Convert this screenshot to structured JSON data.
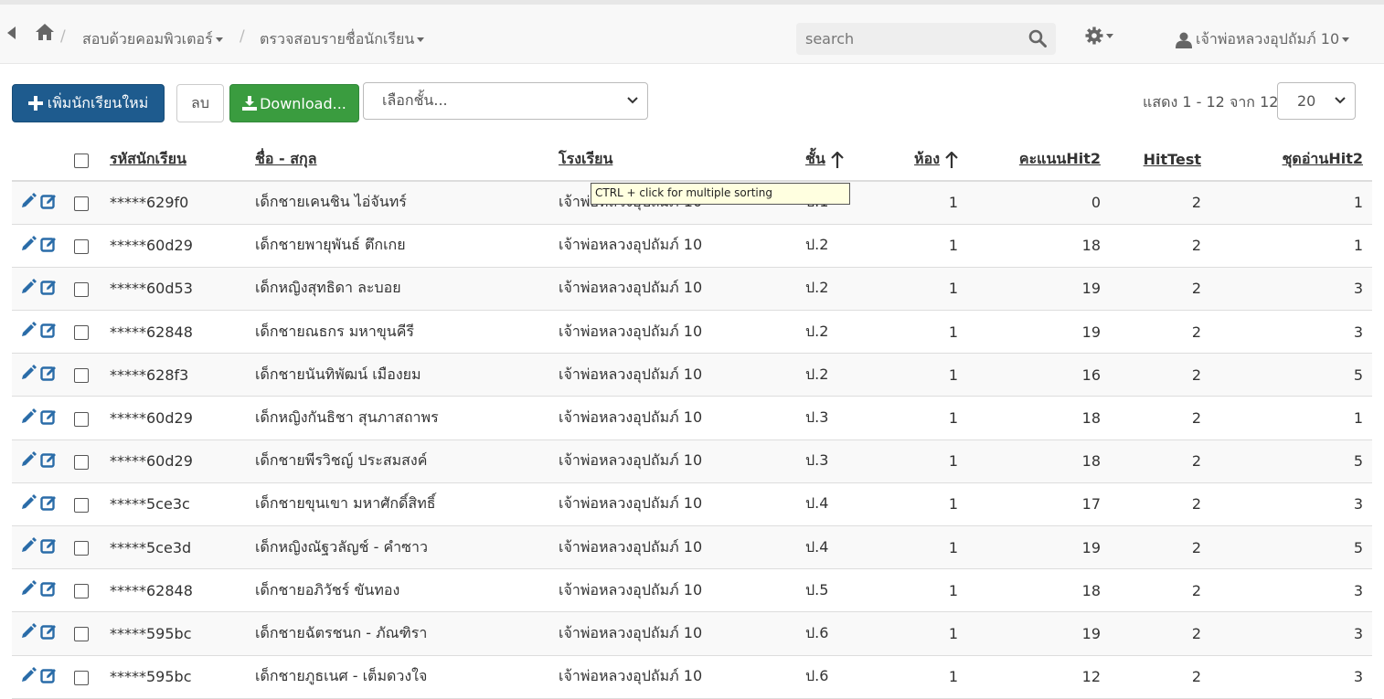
{
  "breadcrumb": {
    "menu1": "สอบด้วยคอมพิวเตอร์",
    "menu2": "ตรวจสอบรายชื่อนักเรียน"
  },
  "search": {
    "placeholder": "search"
  },
  "user": {
    "name": "เจ้าพ่อหลวงอุปถัมภ์ 10"
  },
  "toolbar": {
    "add_label": "เพิ่มนักเรียนใหม่",
    "delete_label": "ลบ",
    "download_label": "Download...",
    "grade_select": "เลือกชั้น...",
    "pager": "แสดง 1 - 12 จาก 12",
    "page_size": "20"
  },
  "tooltip": "CTRL + click for multiple sorting",
  "table": {
    "headers": {
      "id": "รหัสนักเรียน",
      "name": "ชื่อ - สกุล",
      "school": "โรงเรียน",
      "grade": "ชั้น",
      "room": "ห้อง",
      "hit2": "คะแนนHit2",
      "hittest": "HitTest",
      "read": "ชุดอ่านHit2"
    },
    "rows": [
      {
        "id": "*****629f0",
        "name": "เด็กชายเคนชิน ไอ่จันทร์",
        "school": "เจ้าพ่อหลวงอุปถัมภ์ 10",
        "grade": "ป.1",
        "room": "1",
        "hit2": "0",
        "hittest": "2",
        "read": "1"
      },
      {
        "id": "*****60d29",
        "name": "เด็กชายพายุพันธ์ ตึกเกย",
        "school": "เจ้าพ่อหลวงอุปถัมภ์ 10",
        "grade": "ป.2",
        "room": "1",
        "hit2": "18",
        "hittest": "2",
        "read": "1"
      },
      {
        "id": "*****60d53",
        "name": "เด็กหญิงสุทธิดา ละบอย",
        "school": "เจ้าพ่อหลวงอุปถัมภ์ 10",
        "grade": "ป.2",
        "room": "1",
        "hit2": "19",
        "hittest": "2",
        "read": "3"
      },
      {
        "id": "*****62848",
        "name": "เด็กชายณธกร มหาขุนคีรี",
        "school": "เจ้าพ่อหลวงอุปถัมภ์ 10",
        "grade": "ป.2",
        "room": "1",
        "hit2": "19",
        "hittest": "2",
        "read": "3"
      },
      {
        "id": "*****628f3",
        "name": "เด็กชายนันทิพัฒน์ เมืองยม",
        "school": "เจ้าพ่อหลวงอุปถัมภ์ 10",
        "grade": "ป.2",
        "room": "1",
        "hit2": "16",
        "hittest": "2",
        "read": "5"
      },
      {
        "id": "*****60d29",
        "name": "เด็กหญิงกันธิชา สุนภาสถาพร",
        "school": "เจ้าพ่อหลวงอุปถัมภ์ 10",
        "grade": "ป.3",
        "room": "1",
        "hit2": "18",
        "hittest": "2",
        "read": "1"
      },
      {
        "id": "*****60d29",
        "name": "เด็กชายพีรวิชญ์ ประสมสงค์",
        "school": "เจ้าพ่อหลวงอุปถัมภ์ 10",
        "grade": "ป.3",
        "room": "1",
        "hit2": "18",
        "hittest": "2",
        "read": "5"
      },
      {
        "id": "*****5ce3c",
        "name": "เด็กชายขุนเขา มหาศักดิ์สิทธิ์",
        "school": "เจ้าพ่อหลวงอุปถัมภ์ 10",
        "grade": "ป.4",
        "room": "1",
        "hit2": "17",
        "hittest": "2",
        "read": "3"
      },
      {
        "id": "*****5ce3d",
        "name": "เด็กหญิงณัฐวลัญช์ - คำซาว",
        "school": "เจ้าพ่อหลวงอุปถัมภ์ 10",
        "grade": "ป.4",
        "room": "1",
        "hit2": "19",
        "hittest": "2",
        "read": "5"
      },
      {
        "id": "*****62848",
        "name": "เด็กชายอภิวัชร์ ขันทอง",
        "school": "เจ้าพ่อหลวงอุปถัมภ์ 10",
        "grade": "ป.5",
        "room": "1",
        "hit2": "18",
        "hittest": "2",
        "read": "3"
      },
      {
        "id": "*****595bc",
        "name": "เด็กชายฉัตรชนก - ภัณฑิรา",
        "school": "เจ้าพ่อหลวงอุปถัมภ์ 10",
        "grade": "ป.6",
        "room": "1",
        "hit2": "19",
        "hittest": "2",
        "read": "3"
      },
      {
        "id": "*****595bc",
        "name": "เด็กชายภูธเนศ - เต็มดวงใจ",
        "school": "เจ้าพ่อหลวงอุปถัมภ์ 10",
        "grade": "ป.6",
        "room": "1",
        "hit2": "12",
        "hittest": "2",
        "read": "3"
      }
    ]
  },
  "colors": {
    "primary": "#1e5b8e",
    "success": "#3a9c3f",
    "icon_blue": "#2a6ca8",
    "tooltip_bg": "#ffffe0"
  }
}
